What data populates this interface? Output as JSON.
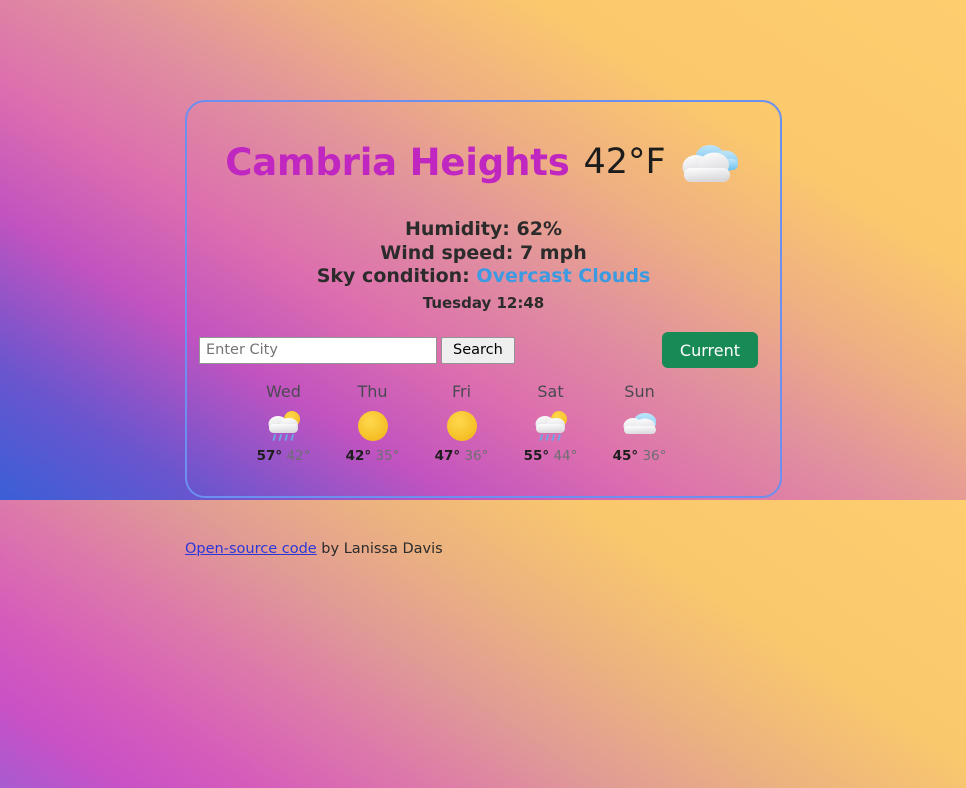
{
  "background": {
    "top_gradient": [
      "#3a5fd7",
      "#c253c0",
      "#e08f9f",
      "#fdcd6e"
    ],
    "bottom_gradient": [
      "#a85ad0",
      "#d55bbb",
      "#ecb37f",
      "#fdcd6f"
    ]
  },
  "card": {
    "border_color": "#6c8ff0",
    "city": "Cambria Heights",
    "temperature": "42°F",
    "condition_icon": "overcast-clouds-icon",
    "details": {
      "humidity": "Humidity: 62%",
      "wind": "Wind speed: 7 mph",
      "sky_label": "Sky condition:",
      "sky_value": "Overcast Clouds",
      "sky_value_color": "#3b9ae1",
      "datetime": "Tuesday 12:48"
    },
    "controls": {
      "search_placeholder": "Enter City",
      "search_value": "",
      "search_button": "Search",
      "current_button": "Current",
      "current_button_color": "#178a56"
    },
    "forecast": [
      {
        "day": "Wed",
        "icon": "sun-behind-rain-cloud-icon",
        "high": "57°",
        "low": "42°"
      },
      {
        "day": "Thu",
        "icon": "sun-icon",
        "high": "42°",
        "low": "35°"
      },
      {
        "day": "Fri",
        "icon": "sun-icon",
        "high": "47°",
        "low": "36°"
      },
      {
        "day": "Sat",
        "icon": "sun-behind-rain-cloud-icon",
        "high": "55°",
        "low": "44°"
      },
      {
        "day": "Sun",
        "icon": "cloud-icon",
        "high": "45°",
        "low": "36°"
      }
    ]
  },
  "footer": {
    "link_text": "Open-source code",
    "rest_text": " by Lanissa Davis",
    "link_color": "#2b37d8"
  }
}
